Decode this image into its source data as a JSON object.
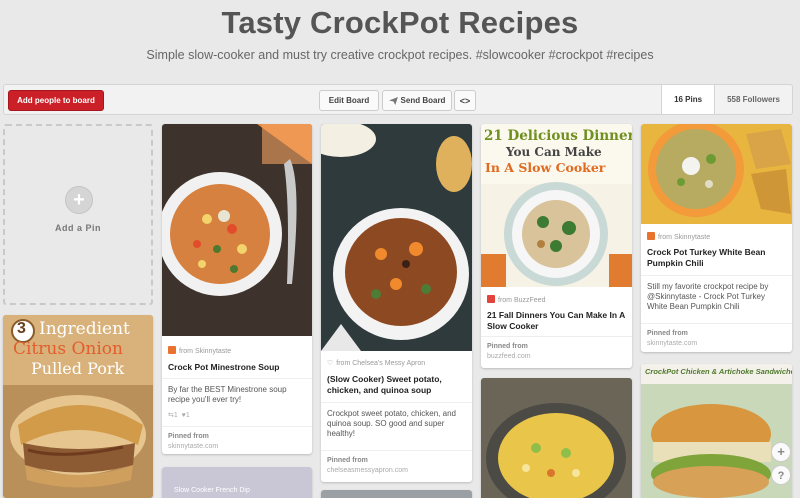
{
  "board": {
    "title": "Tasty CrockPot Recipes",
    "description": "Simple slow-cooker and must try creative crockpot recipes. #slowcooker #crockpot #recipes"
  },
  "actions": {
    "add_people": "Add people to board",
    "edit_board": "Edit Board",
    "send_board": "Send Board",
    "embed_icon": "<>"
  },
  "stats": {
    "pins": "16 Pins",
    "followers": "558 Followers"
  },
  "add_pin": {
    "label": "Add a Pin",
    "icon": "+"
  },
  "pins": [
    {
      "source": "from Skinnytaste",
      "title": "Crock Pot Minestrone Soup",
      "description": "By far the BEST Minestrone soup recipe you'll ever try!",
      "repins": "1",
      "likes": "1",
      "pinned_from": "Pinned from",
      "url": "skinnytaste.com"
    },
    {
      "source": "from Chelsea's Messy Apron",
      "title": "(Slow Cooker) Sweet potato, chicken, and quinoa soup",
      "description": "Crockpot sweet potato, chicken, and quinoa soup. SO good and super healthy!",
      "pinned_from": "Pinned from",
      "url": "chelseasmessyapron.com"
    },
    {
      "image_text_1": "21 Delicious Dinners",
      "image_text_2": "You Can Make",
      "image_text_3": "In A Slow Cooker",
      "source": "from BuzzFeed",
      "title": "21 Fall Dinners You Can Make In A Slow Cooker",
      "pinned_from": "Pinned from",
      "url": "buzzfeed.com"
    },
    {
      "source": "from Skinnytaste",
      "title": "Crock Pot Turkey White Bean Pumpkin Chili",
      "description": "Still my favorite crockpot recipe by @Skinnytaste - Crock Pot Turkey White Bean Pumpkin Chili",
      "pinned_from": "Pinned from",
      "url": "skinnytaste.com"
    },
    {
      "image_text_1": "3",
      "image_text_2": "Ingredient",
      "image_text_3": "Citrus Onion",
      "image_text_4": "Pulled Pork"
    },
    {
      "image_text_1": "CrockPot Chicken & Artichoke Sandwiches"
    },
    {
      "image_text_1": "Slow Cooker French Dip"
    }
  ],
  "float": {
    "plus": "+",
    "help": "?"
  },
  "colors": {
    "brand_red": "#cb2027",
    "background": "#e9e9e9"
  }
}
